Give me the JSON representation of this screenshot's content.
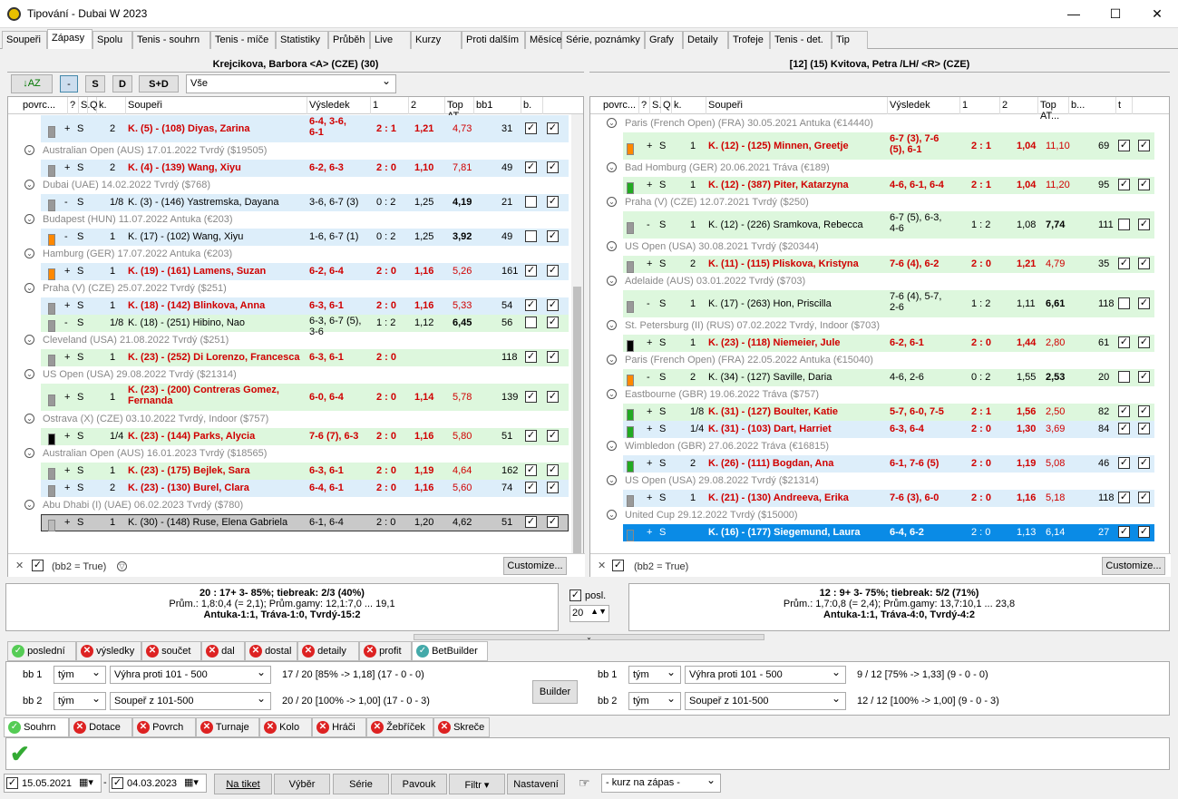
{
  "window": {
    "title": "Tipování - Dubai W 2023"
  },
  "tabs": [
    "Soupeři",
    "Zápasy",
    "Spolu",
    "Tenis - souhrn",
    "Tenis - míče",
    "Statistiky",
    "Průběh",
    "Live",
    "Kurzy",
    "Proti dalším",
    "Měsíce",
    "Série, poznámky",
    "Grafy",
    "Detaily",
    "Trofeje",
    "Tenis - det.",
    "Tip"
  ],
  "left": {
    "player": "Krejcikova, Barbora <A> (CZE) (30)",
    "toolbar": {
      "b1": "-",
      "b2": "S",
      "b3": "D",
      "b4": "S+D",
      "filter": "Vše"
    },
    "headers": [
      "povrc...",
      "?",
      "S.",
      "Q",
      "k.",
      "Soupeři",
      "Výsledek",
      "1",
      "2",
      "Top AT...",
      "bb1",
      "b."
    ],
    "rows": [
      {
        "t": "m",
        "cls": "blue",
        "c1": "+",
        "c2": "S",
        "k": "2",
        "opp": "K. (5) - (108) Diyas, Zarina",
        "res": "6-4, 3-6,",
        "res2": "6-1",
        "sc": "2 : 1",
        "o1": "1,21",
        "o2": "4,73",
        "top": "31",
        "bb1": true,
        "bb2": true,
        "red": true,
        "bar": "#999",
        "h": 30
      },
      {
        "t": "g",
        "text": "Australian Open (AUS) 17.01.2022  Tvrdý  ($19505)"
      },
      {
        "t": "m",
        "cls": "blue",
        "c1": "+",
        "c2": "S",
        "k": "2",
        "opp": "K. (4) - (139) Wang, Xiyu",
        "res": "6-2, 6-3",
        "sc": "2 : 0",
        "o1": "1,10",
        "o2": "7,81",
        "top": "49",
        "bb1": true,
        "bb2": true,
        "red": true,
        "bar": "#999"
      },
      {
        "t": "g",
        "text": "Dubai (UAE) 14.02.2022  Tvrdý  ($768)"
      },
      {
        "t": "m",
        "cls": "blue",
        "c1": "-",
        "c2": "S",
        "k": "1/8",
        "opp": "K. (3) - (146) Yastremska, Dayana",
        "res": "3-6, 6-7 (3)",
        "sc": "0 : 2",
        "o1": "1,25",
        "o2": "4,19",
        "top": "21",
        "bb1": false,
        "bb2": true,
        "red": false,
        "bar": "#999",
        "o2bold": true
      },
      {
        "t": "g",
        "text": "Budapest (HUN) 11.07.2022  Antuka  (€203)"
      },
      {
        "t": "m",
        "cls": "blue",
        "c1": "-",
        "c2": "S",
        "k": "1",
        "opp": "K. (17) - (102) Wang, Xiyu",
        "res": "1-6, 6-7 (1)",
        "sc": "0 : 2",
        "o1": "1,25",
        "o2": "3,92",
        "top": "49",
        "bb1": false,
        "bb2": true,
        "red": false,
        "bar": "#f80",
        "o2bold": true
      },
      {
        "t": "g",
        "text": "Hamburg (GER) 17.07.2022  Antuka  (€203)"
      },
      {
        "t": "m",
        "cls": "blue",
        "c1": "+",
        "c2": "S",
        "k": "1",
        "opp": "K. (19) - (161) Lamens, Suzan",
        "res": "6-2, 6-4",
        "sc": "2 : 0",
        "o1": "1,16",
        "o2": "5,26",
        "top": "161",
        "bb1": true,
        "bb2": true,
        "red": true,
        "bar": "#f80"
      },
      {
        "t": "g",
        "text": "Praha (V) (CZE) 25.07.2022  Tvrdý  ($251)"
      },
      {
        "t": "m",
        "cls": "blue",
        "c1": "+",
        "c2": "S",
        "k": "1",
        "opp": "K. (18) - (142) Blinkova, Anna",
        "res": "6-3, 6-1",
        "sc": "2 : 0",
        "o1": "1,16",
        "o2": "5,33",
        "top": "54",
        "bb1": true,
        "bb2": true,
        "red": true,
        "bar": "#999"
      },
      {
        "t": "m",
        "cls": "green",
        "c1": "-",
        "c2": "S",
        "k": "1/8",
        "opp": "K. (18) - (251) Hibino, Nao",
        "res": "6-3, 6-7 (5),",
        "res2": "3-6",
        "sc": "1 : 2",
        "o1": "1,12",
        "o2": "6,45",
        "top": "56",
        "bb1": false,
        "bb2": true,
        "red": false,
        "bar": "#999",
        "o2bold": true,
        "h": 19
      },
      {
        "t": "g",
        "text": "Cleveland (USA) 21.08.2022  Tvrdý  ($251)"
      },
      {
        "t": "m",
        "cls": "green",
        "c1": "+",
        "c2": "S",
        "k": "1",
        "opp": "K. (23) - (252) Di Lorenzo, Francesca",
        "res": "6-3, 6-1",
        "sc": "2 : 0",
        "o1": "",
        "o2": "",
        "top": "118",
        "bb1": true,
        "bb2": true,
        "red": true,
        "bar": "#999"
      },
      {
        "t": "g",
        "text": "US Open (USA) 29.08.2022  Tvrdý  ($21314)"
      },
      {
        "t": "m",
        "cls": "green",
        "c1": "+",
        "c2": "S",
        "k": "1",
        "opp": "K. (23) - (200) Contreras Gomez,",
        "opp2": "Fernanda",
        "res": "6-0, 6-4",
        "sc": "2 : 0",
        "o1": "1,14",
        "o2": "5,78",
        "top": "139",
        "bb1": true,
        "bb2": true,
        "red": true,
        "bar": "#999",
        "h": 30
      },
      {
        "t": "g",
        "text": "Ostrava (X) (CZE) 03.10.2022  Tvrdý, Indoor  ($757)"
      },
      {
        "t": "m",
        "cls": "green",
        "c1": "+",
        "c2": "S",
        "k": "1/4",
        "opp": "K. (23) - (144) Parks, Alycia",
        "res": "7-6 (7), 6-3",
        "sc": "2 : 0",
        "o1": "1,16",
        "o2": "5,80",
        "top": "51",
        "bb1": true,
        "bb2": true,
        "red": true,
        "bar": "#000"
      },
      {
        "t": "g",
        "text": "Australian Open (AUS) 16.01.2023  Tvrdý  ($18565)"
      },
      {
        "t": "m",
        "cls": "green",
        "c1": "+",
        "c2": "S",
        "k": "1",
        "opp": "K. (23) - (175) Bejlek, Sara",
        "res": "6-3, 6-1",
        "sc": "2 : 0",
        "o1": "1,19",
        "o2": "4,64",
        "top": "162",
        "bb1": true,
        "bb2": true,
        "red": true,
        "bar": "#999"
      },
      {
        "t": "m",
        "cls": "blue",
        "c1": "+",
        "c2": "S",
        "k": "2",
        "opp": "K. (23) - (130) Burel, Clara",
        "res": "6-4, 6-1",
        "sc": "2 : 0",
        "o1": "1,16",
        "o2": "5,60",
        "top": "74",
        "bb1": true,
        "bb2": true,
        "red": true,
        "bar": "#999"
      },
      {
        "t": "g",
        "text": "Abu Dhabi (I) (UAE) 06.02.2023  Tvrdý  ($780)"
      },
      {
        "t": "m",
        "cls": "sel",
        "c1": "+",
        "c2": "S",
        "k": "1",
        "opp": "K. (30) - (148) Ruse, Elena Gabriela",
        "res": "6-1, 6-4",
        "sc": "2 : 0",
        "o1": "1,20",
        "o2": "4,62",
        "top": "51",
        "bb1": true,
        "bb2": true,
        "red": false,
        "bar": "#bbb"
      }
    ],
    "filter_text": "(bb2 = True)",
    "customize": "Customize...",
    "summary": {
      "l1": "20 : 17+  3-  85%; tiebreak: 2/3 (40%)",
      "l2": "Prům.: 1,8:0,4 (= 2,1);  Prům.gamy: 12,1:7,0 ... 19,1",
      "l3": "Antuka-1:1, Tráva-1:0, Tvrdý-15:2"
    }
  },
  "right": {
    "player": "[12] (15) Kvitova, Petra /LH/ <R> (CZE)",
    "headers": [
      "povrc...",
      "?",
      "S.",
      "Q",
      "k.",
      "Soupeři",
      "Výsledek",
      "1",
      "2",
      "Top AT...",
      "b...",
      "t"
    ],
    "rows": [
      {
        "t": "g",
        "text": "Paris (French Open) (FRA) 30.05.2021  Antuka  (€14440)"
      },
      {
        "t": "m",
        "cls": "green",
        "c1": "+",
        "c2": "S",
        "k": "1",
        "opp": "K. (12) - (125) Minnen, Greetje",
        "res": "6-7 (3), 7-6",
        "res2": "(5), 6-1",
        "sc": "2 : 1",
        "o1": "1,04",
        "o2": "11,10",
        "top": "69",
        "bb1": true,
        "bb2": true,
        "red": true,
        "bar": "#f80",
        "h": 30
      },
      {
        "t": "g",
        "text": "Bad Homburg (GER) 20.06.2021  Tráva  (€189)"
      },
      {
        "t": "m",
        "cls": "green",
        "c1": "+",
        "c2": "S",
        "k": "1",
        "opp": "K. (12) - (387) Piter, Katarzyna",
        "res": "4-6, 6-1, 6-4",
        "sc": "2 : 1",
        "o1": "1,04",
        "o2": "11,20",
        "top": "95",
        "bb1": true,
        "bb2": true,
        "red": true,
        "bar": "#2a2"
      },
      {
        "t": "g",
        "text": "Praha (V) (CZE) 12.07.2021  Tvrdý  ($250)"
      },
      {
        "t": "m",
        "cls": "green",
        "c1": "-",
        "c2": "S",
        "k": "1",
        "opp": "K. (12) - (226) Sramkova, Rebecca",
        "res": "6-7 (5), 6-3,",
        "res2": "4-6",
        "sc": "1 : 2",
        "o1": "1,08",
        "o2": "7,74",
        "top": "111",
        "bb1": false,
        "bb2": true,
        "red": false,
        "bar": "#999",
        "o2bold": true,
        "h": 30
      },
      {
        "t": "g",
        "text": "US Open (USA) 30.08.2021  Tvrdý  ($20344)"
      },
      {
        "t": "m",
        "cls": "green",
        "c1": "+",
        "c2": "S",
        "k": "2",
        "opp": "K. (11) - (115) Pliskova, Kristyna",
        "res": "7-6 (4), 6-2",
        "sc": "2 : 0",
        "o1": "1,21",
        "o2": "4,79",
        "top": "35",
        "bb1": true,
        "bb2": true,
        "red": true,
        "bar": "#999"
      },
      {
        "t": "g",
        "text": "Adelaide (AUS) 03.01.2022  Tvrdý  ($703)"
      },
      {
        "t": "m",
        "cls": "green",
        "c1": "-",
        "c2": "S",
        "k": "1",
        "opp": "K. (17) - (263) Hon, Priscilla",
        "res": "7-6 (4), 5-7,",
        "res2": "2-6",
        "sc": "1 : 2",
        "o1": "1,11",
        "o2": "6,61",
        "top": "118",
        "bb1": false,
        "bb2": true,
        "red": false,
        "bar": "#999",
        "o2bold": true,
        "h": 30
      },
      {
        "t": "g",
        "text": "St. Petersburg (II) (RUS) 07.02.2022  Tvrdý, Indoor  ($703)"
      },
      {
        "t": "m",
        "cls": "green",
        "c1": "+",
        "c2": "S",
        "k": "1",
        "opp": "K. (23) - (118) Niemeier, Jule",
        "res": "6-2, 6-1",
        "sc": "2 : 0",
        "o1": "1,44",
        "o2": "2,80",
        "top": "61",
        "bb1": true,
        "bb2": true,
        "red": true,
        "bar": "#000"
      },
      {
        "t": "g",
        "text": "Paris (French Open) (FRA) 22.05.2022  Antuka  (€15040)"
      },
      {
        "t": "m",
        "cls": "green",
        "c1": "-",
        "c2": "S",
        "k": "2",
        "opp": "K. (34) - (127) Saville, Daria",
        "res": "4-6, 2-6",
        "sc": "0 : 2",
        "o1": "1,55",
        "o2": "2,53",
        "top": "20",
        "bb1": false,
        "bb2": true,
        "red": false,
        "bar": "#f80",
        "o2bold": true
      },
      {
        "t": "g",
        "text": "Eastbourne (GBR) 19.06.2022  Tráva  ($757)"
      },
      {
        "t": "m",
        "cls": "green",
        "c1": "+",
        "c2": "S",
        "k": "1/8",
        "opp": "K. (31) - (127) Boulter, Katie",
        "res": "5-7, 6-0, 7-5",
        "sc": "2 : 1",
        "o1": "1,56",
        "o2": "2,50",
        "top": "82",
        "bb1": true,
        "bb2": true,
        "red": true,
        "bar": "#2a2"
      },
      {
        "t": "m",
        "cls": "blue",
        "c1": "+",
        "c2": "S",
        "k": "1/4",
        "opp": "K. (31) - (103) Dart, Harriet",
        "res": "6-3, 6-4",
        "sc": "2 : 0",
        "o1": "1,30",
        "o2": "3,69",
        "top": "84",
        "bb1": true,
        "bb2": true,
        "red": true,
        "bar": "#2a2"
      },
      {
        "t": "g",
        "text": "Wimbledon (GBR) 27.06.2022  Tráva  (€16815)"
      },
      {
        "t": "m",
        "cls": "blue",
        "c1": "+",
        "c2": "S",
        "k": "2",
        "opp": "K. (26) - (111) Bogdan, Ana",
        "res": "6-1, 7-6 (5)",
        "sc": "2 : 0",
        "o1": "1,19",
        "o2": "5,08",
        "top": "46",
        "bb1": true,
        "bb2": true,
        "red": true,
        "bar": "#2a2"
      },
      {
        "t": "g",
        "text": "US Open (USA) 29.08.2022  Tvrdý  ($21314)"
      },
      {
        "t": "m",
        "cls": "blue",
        "c1": "+",
        "c2": "S",
        "k": "1",
        "opp": "K. (21) - (130) Andreeva, Erika",
        "res": "7-6 (3), 6-0",
        "sc": "2 : 0",
        "o1": "1,16",
        "o2": "5,18",
        "top": "118",
        "bb1": true,
        "bb2": true,
        "red": true,
        "bar": "#999"
      },
      {
        "t": "g",
        "text": "United Cup 29.12.2022  Tvrdý  ($15000)"
      },
      {
        "t": "m",
        "cls": "hl",
        "c1": "+",
        "c2": "S",
        "k": "",
        "opp": "K. (16) - (177) Siegemund, Laura",
        "res": "6-4, 6-2",
        "sc": "2 : 0",
        "o1": "1,13",
        "o2": "6,14",
        "top": "27",
        "bb1": true,
        "bb2": true,
        "red": false,
        "bar": "#1a90e0"
      }
    ],
    "filter_text": "(bb2 = True)",
    "customize": "Customize...",
    "summary": {
      "l1": "12 : 9+  3-  75%; tiebreak: 5/2 (71%)",
      "l2": "Prům.: 1,7:0,8 (= 2,4);  Prům.gamy: 13,7:10,1 ... 23,8",
      "l3": "Antuka-1:1, Tráva-4:0, Tvrdý-4:2"
    }
  },
  "posl": {
    "label": "posl.",
    "value": "20"
  },
  "bettabs": [
    "poslední",
    "výsledky",
    "součet",
    "dal",
    "dostal",
    "detaily",
    "profit",
    "BetBuilder"
  ],
  "bb": {
    "left": [
      {
        "label": "bb 1",
        "who": "tým",
        "cond": "Výhra proti 101 - 500",
        "res": "17 / 20 [85% -> 1,18] (17 - 0 - 0)"
      },
      {
        "label": "bb 2",
        "who": "tým",
        "cond": "Soupeř z 101-500",
        "res": "20 / 20 [100% -> 1,00] (17 - 0 - 3)"
      }
    ],
    "right": [
      {
        "label": "bb 1",
        "who": "tým",
        "cond": "Výhra proti 101 - 500",
        "res": "9 / 12 [75% -> 1,33] (9 - 0 - 0)"
      },
      {
        "label": "bb 2",
        "who": "tým",
        "cond": "Soupeř z 101-500",
        "res": "12 / 12 [100% -> 1,00] (9 - 0 - 3)"
      }
    ],
    "builder": "Builder"
  },
  "sumtabs": [
    "Souhrn",
    "Dotace",
    "Povrch",
    "Turnaje",
    "Kolo",
    "Hráči",
    "Žebříček",
    "Skreče"
  ],
  "footer": {
    "date1": "15.05.2021",
    "date2": "04.03.2023",
    "b1": "Na tiket",
    "b2": "Výběr",
    "b3": "Série",
    "b4": "Pavouk",
    "b5": "Filtr",
    "b6": "Nastavení",
    "kurz": "- kurz na zápas -"
  }
}
